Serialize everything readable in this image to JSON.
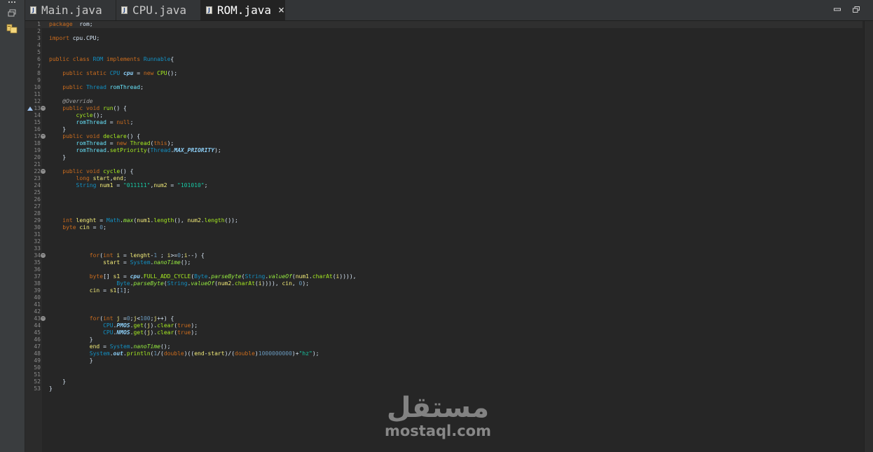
{
  "tabs": [
    {
      "label": "Main.java",
      "active": false
    },
    {
      "label": "CPU.java",
      "active": false
    },
    {
      "label": "ROM.java",
      "active": true
    }
  ],
  "active_tab_close": "×",
  "colors": {
    "background": "#262626",
    "keyword": "#cc6c1d",
    "type": "#1290c3",
    "field": "#66e1f8",
    "method": "#a7ec21",
    "string": "#17c6a3",
    "default": "#d9e8f7"
  },
  "icons": [
    "java-file-icon",
    "close-icon",
    "minimize-icon",
    "maximize-icon",
    "restore-icon",
    "package-explorer-icon",
    "fold-icon",
    "override-marker-icon"
  ],
  "editor": {
    "lines": [
      {
        "n": "1",
        "current": true,
        "t": [
          [
            "kw",
            "package"
          ],
          [
            "",
            "  rom;"
          ]
        ]
      },
      {
        "n": "2",
        "t": []
      },
      {
        "n": "3",
        "t": [
          [
            "kw",
            "import"
          ],
          [
            "",
            " cpu.CPU;"
          ]
        ]
      },
      {
        "n": "4",
        "t": []
      },
      {
        "n": "5",
        "t": []
      },
      {
        "n": "6",
        "t": [
          [
            "kw",
            "public class "
          ],
          [
            "ty",
            "ROM"
          ],
          [
            "kw",
            " implements "
          ],
          [
            "ty",
            "Runnable"
          ],
          [
            "",
            "{"
          ]
        ]
      },
      {
        "n": "7",
        "t": []
      },
      {
        "n": "8",
        "t": [
          [
            "",
            "    "
          ],
          [
            "kw",
            "public static "
          ],
          [
            "ty",
            "CPU "
          ],
          [
            "sfld",
            "cpu"
          ],
          [
            "",
            " = "
          ],
          [
            "kw",
            "new "
          ],
          [
            "fn",
            "CPU"
          ],
          [
            "",
            "();"
          ]
        ]
      },
      {
        "n": "9",
        "t": []
      },
      {
        "n": "10",
        "t": [
          [
            "",
            "    "
          ],
          [
            "kw",
            "public "
          ],
          [
            "ty",
            "Thread "
          ],
          [
            "fld",
            "romThread"
          ],
          [
            "",
            ";"
          ]
        ]
      },
      {
        "n": "11",
        "t": []
      },
      {
        "n": "12",
        "t": [
          [
            "",
            "    "
          ],
          [
            "ann",
            "@Override"
          ]
        ]
      },
      {
        "n": "13",
        "fold": true,
        "marker": true,
        "t": [
          [
            "",
            "    "
          ],
          [
            "kw",
            "public void "
          ],
          [
            "fn",
            "run"
          ],
          [
            "",
            "() {"
          ]
        ]
      },
      {
        "n": "14",
        "t": [
          [
            "",
            "        "
          ],
          [
            "fn",
            "cycle"
          ],
          [
            "",
            "();"
          ]
        ]
      },
      {
        "n": "15",
        "t": [
          [
            "",
            "        "
          ],
          [
            "fld",
            "romThread"
          ],
          [
            "",
            " = "
          ],
          [
            "kw",
            "null"
          ],
          [
            "",
            ";"
          ]
        ]
      },
      {
        "n": "16",
        "t": [
          [
            "",
            "    }"
          ]
        ]
      },
      {
        "n": "17",
        "fold": true,
        "t": [
          [
            "",
            "    "
          ],
          [
            "kw",
            "public void "
          ],
          [
            "fn",
            "declare"
          ],
          [
            "",
            "() {"
          ]
        ]
      },
      {
        "n": "18",
        "t": [
          [
            "",
            "        "
          ],
          [
            "fld",
            "romThread"
          ],
          [
            "",
            " = "
          ],
          [
            "kw",
            "new "
          ],
          [
            "fn",
            "Thread"
          ],
          [
            "",
            "("
          ],
          [
            "kw",
            "this"
          ],
          [
            "",
            ");"
          ]
        ]
      },
      {
        "n": "19",
        "t": [
          [
            "",
            "        "
          ],
          [
            "fld",
            "romThread"
          ],
          [
            "",
            "."
          ],
          [
            "fn",
            "setPriority"
          ],
          [
            "",
            "("
          ],
          [
            "ty",
            "Thread"
          ],
          [
            "",
            "."
          ],
          [
            "sfld",
            "MAX_PRIORITY"
          ],
          [
            "",
            ");"
          ]
        ]
      },
      {
        "n": "20",
        "t": [
          [
            "",
            "    }"
          ]
        ]
      },
      {
        "n": "21",
        "t": []
      },
      {
        "n": "22",
        "fold": true,
        "t": [
          [
            "",
            "    "
          ],
          [
            "kw",
            "public void "
          ],
          [
            "fn",
            "cycle"
          ],
          [
            "",
            "() {"
          ]
        ]
      },
      {
        "n": "23",
        "t": [
          [
            "",
            "        "
          ],
          [
            "kw",
            "long "
          ],
          [
            "loc",
            "start"
          ],
          [
            "",
            ","
          ],
          [
            "loc",
            "end"
          ],
          [
            "",
            ";"
          ]
        ]
      },
      {
        "n": "24",
        "t": [
          [
            "",
            "        "
          ],
          [
            "ty",
            "String "
          ],
          [
            "loc",
            "num1"
          ],
          [
            "",
            " = "
          ],
          [
            "str",
            "\"011111\""
          ],
          [
            "",
            ","
          ],
          [
            "loc",
            "num2"
          ],
          [
            "",
            " = "
          ],
          [
            "str",
            "\"101010\""
          ],
          [
            "",
            ";"
          ]
        ]
      },
      {
        "n": "25",
        "t": []
      },
      {
        "n": "26",
        "t": []
      },
      {
        "n": "27",
        "t": []
      },
      {
        "n": "28",
        "t": []
      },
      {
        "n": "29",
        "t": [
          [
            "",
            "    "
          ],
          [
            "kw",
            "int "
          ],
          [
            "loc",
            "lenght"
          ],
          [
            "",
            " = "
          ],
          [
            "ty",
            "Math"
          ],
          [
            "",
            "."
          ],
          [
            "sfn",
            "max"
          ],
          [
            "",
            "("
          ],
          [
            "loc",
            "num1"
          ],
          [
            "",
            "."
          ],
          [
            "fn",
            "length"
          ],
          [
            "",
            "(), "
          ],
          [
            "loc",
            "num2"
          ],
          [
            "",
            "."
          ],
          [
            "fn",
            "length"
          ],
          [
            "",
            "());"
          ]
        ]
      },
      {
        "n": "30",
        "t": [
          [
            "",
            "    "
          ],
          [
            "kw",
            "byte "
          ],
          [
            "loc",
            "cin"
          ],
          [
            "",
            " = "
          ],
          [
            "num",
            "0"
          ],
          [
            "",
            ";"
          ]
        ]
      },
      {
        "n": "31",
        "t": []
      },
      {
        "n": "32",
        "t": []
      },
      {
        "n": "33",
        "t": []
      },
      {
        "n": "34",
        "fold": true,
        "t": [
          [
            "",
            "            "
          ],
          [
            "kw",
            "for"
          ],
          [
            "",
            "("
          ],
          [
            "kw",
            "int "
          ],
          [
            "loc",
            "i"
          ],
          [
            "",
            " = "
          ],
          [
            "loc",
            "lenght"
          ],
          [
            "",
            "-"
          ],
          [
            "num",
            "1"
          ],
          [
            "",
            " ; "
          ],
          [
            "loc",
            "i"
          ],
          [
            "",
            ">="
          ],
          [
            "num",
            "0"
          ],
          [
            "",
            ";"
          ],
          [
            "loc",
            "i"
          ],
          [
            "",
            "--) {"
          ]
        ]
      },
      {
        "n": "35",
        "t": [
          [
            "",
            "                "
          ],
          [
            "loc",
            "start"
          ],
          [
            "",
            " = "
          ],
          [
            "ty",
            "System"
          ],
          [
            "",
            "."
          ],
          [
            "sfn",
            "nanoTime"
          ],
          [
            "",
            "();"
          ]
        ]
      },
      {
        "n": "36",
        "t": []
      },
      {
        "n": "37",
        "t": [
          [
            "",
            "            "
          ],
          [
            "kw",
            "byte"
          ],
          [
            "",
            "[] "
          ],
          [
            "loc",
            "s1"
          ],
          [
            "",
            " = "
          ],
          [
            "sfld",
            "cpu"
          ],
          [
            "",
            "."
          ],
          [
            "fn",
            "FULL_ADD_CYCLE"
          ],
          [
            "",
            "("
          ],
          [
            "ty",
            "Byte"
          ],
          [
            "",
            "."
          ],
          [
            "sfn",
            "parseByte"
          ],
          [
            "",
            "("
          ],
          [
            "ty",
            "String"
          ],
          [
            "",
            "."
          ],
          [
            "sfn",
            "valueOf"
          ],
          [
            "",
            "("
          ],
          [
            "loc",
            "num1"
          ],
          [
            "",
            "."
          ],
          [
            "fn",
            "charAt"
          ],
          [
            "",
            "("
          ],
          [
            "loc",
            "i"
          ],
          [
            "",
            ")))),"
          ]
        ]
      },
      {
        "n": "38",
        "t": [
          [
            "",
            "                    "
          ],
          [
            "ty",
            "Byte"
          ],
          [
            "",
            "."
          ],
          [
            "sfn",
            "parseByte"
          ],
          [
            "",
            "("
          ],
          [
            "ty",
            "String"
          ],
          [
            "",
            "."
          ],
          [
            "sfn",
            "valueOf"
          ],
          [
            "",
            "("
          ],
          [
            "loc",
            "num2"
          ],
          [
            "",
            "."
          ],
          [
            "fn",
            "charAt"
          ],
          [
            "",
            "("
          ],
          [
            "loc",
            "i"
          ],
          [
            "",
            ")))), "
          ],
          [
            "loc",
            "cin"
          ],
          [
            "",
            ", "
          ],
          [
            "num",
            "0"
          ],
          [
            "",
            ");"
          ]
        ]
      },
      {
        "n": "39",
        "t": [
          [
            "",
            "            "
          ],
          [
            "loc",
            "cin"
          ],
          [
            "",
            " = "
          ],
          [
            "loc",
            "s1"
          ],
          [
            "",
            "["
          ],
          [
            "num",
            "1"
          ],
          [
            "",
            "];"
          ]
        ]
      },
      {
        "n": "40",
        "t": []
      },
      {
        "n": "41",
        "t": []
      },
      {
        "n": "42",
        "t": []
      },
      {
        "n": "43",
        "fold": true,
        "t": [
          [
            "",
            "            "
          ],
          [
            "kw",
            "for"
          ],
          [
            "",
            "("
          ],
          [
            "kw",
            "int "
          ],
          [
            "loc",
            "j"
          ],
          [
            "",
            " ="
          ],
          [
            "num",
            "0"
          ],
          [
            "",
            ";"
          ],
          [
            "loc",
            "j"
          ],
          [
            "",
            "<"
          ],
          [
            "num",
            "100"
          ],
          [
            "",
            ";"
          ],
          [
            "loc",
            "j"
          ],
          [
            "",
            "++) {"
          ]
        ]
      },
      {
        "n": "44",
        "t": [
          [
            "",
            "                "
          ],
          [
            "ty",
            "CPU"
          ],
          [
            "",
            "."
          ],
          [
            "sfld",
            "PMOS"
          ],
          [
            "",
            "."
          ],
          [
            "fn",
            "get"
          ],
          [
            "",
            "("
          ],
          [
            "loc",
            "j"
          ],
          [
            "",
            ")."
          ],
          [
            "fn",
            "clear"
          ],
          [
            "",
            "("
          ],
          [
            "kw",
            "true"
          ],
          [
            "",
            ");"
          ]
        ]
      },
      {
        "n": "45",
        "t": [
          [
            "",
            "                "
          ],
          [
            "ty",
            "CPU"
          ],
          [
            "",
            "."
          ],
          [
            "sfld",
            "NMOS"
          ],
          [
            "",
            "."
          ],
          [
            "fn",
            "get"
          ],
          [
            "",
            "("
          ],
          [
            "loc",
            "j"
          ],
          [
            "",
            ")."
          ],
          [
            "fn",
            "clear"
          ],
          [
            "",
            "("
          ],
          [
            "kw",
            "true"
          ],
          [
            "",
            ");"
          ]
        ]
      },
      {
        "n": "46",
        "t": [
          [
            "",
            "            }"
          ]
        ]
      },
      {
        "n": "47",
        "t": [
          [
            "",
            "            "
          ],
          [
            "loc",
            "end"
          ],
          [
            "",
            " = "
          ],
          [
            "ty",
            "System"
          ],
          [
            "",
            "."
          ],
          [
            "sfn",
            "nanoTime"
          ],
          [
            "",
            "();"
          ]
        ]
      },
      {
        "n": "48",
        "t": [
          [
            "",
            "            "
          ],
          [
            "ty",
            "System"
          ],
          [
            "",
            "."
          ],
          [
            "sfld",
            "out"
          ],
          [
            "",
            "."
          ],
          [
            "fn",
            "println"
          ],
          [
            "",
            "("
          ],
          [
            "num",
            "1"
          ],
          [
            "",
            "/("
          ],
          [
            "kw",
            "double"
          ],
          [
            "",
            ")(("
          ],
          [
            "loc",
            "end"
          ],
          [
            "",
            "-"
          ],
          [
            "loc",
            "start"
          ],
          [
            "",
            ")/("
          ],
          [
            "kw",
            "double"
          ],
          [
            "",
            ")"
          ],
          [
            "num",
            "1000000000"
          ],
          [
            "",
            ")+"
          ],
          [
            "str",
            "\"hz\""
          ],
          [
            "",
            ");"
          ]
        ]
      },
      {
        "n": "49",
        "t": [
          [
            "",
            "            }"
          ]
        ]
      },
      {
        "n": "50",
        "t": []
      },
      {
        "n": "51",
        "t": []
      },
      {
        "n": "52",
        "t": [
          [
            "",
            "    }"
          ]
        ]
      },
      {
        "n": "53",
        "t": [
          [
            "",
            "}"
          ]
        ]
      }
    ]
  },
  "watermark": {
    "arabic": "مستقل",
    "latin": "mostaql.com"
  }
}
